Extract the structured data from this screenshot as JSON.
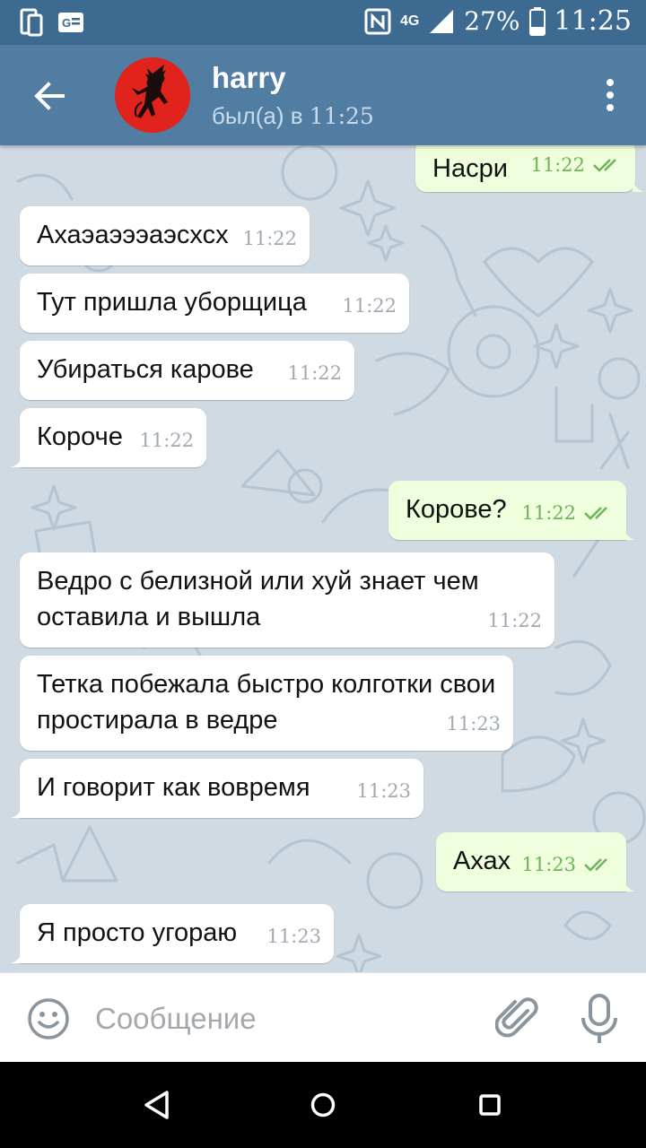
{
  "status_bar": {
    "network": "4G",
    "battery": "27%",
    "time": "11:25",
    "icons": [
      "phone-icon",
      "news-icon",
      "nfc-icon",
      "signal-icon",
      "battery-icon"
    ]
  },
  "header": {
    "contact_name": "harry",
    "last_seen_prefix": "был(а) в",
    "last_seen_time": "11:25",
    "avatar_color": "#e0231c"
  },
  "messages": [
    {
      "dir": "out",
      "text": "Насри",
      "time": "11:22",
      "status": "read"
    },
    {
      "dir": "in",
      "text": "Ахаэаэээаэсхсх",
      "time": "11:22"
    },
    {
      "dir": "in",
      "text": "Тут пришла уборщица",
      "time": "11:22"
    },
    {
      "dir": "in",
      "text": "Убираться карове",
      "time": "11:22"
    },
    {
      "dir": "in",
      "text": "Короче",
      "time": "11:22"
    },
    {
      "dir": "out",
      "text": "Корове?",
      "time": "11:22",
      "status": "read"
    },
    {
      "dir": "in",
      "text": "Ведро с белизной или хуй знает чем оставила и вышла",
      "time": "11:22"
    },
    {
      "dir": "in",
      "text": "Тетка побежала быстро колготки свои простирала в ведре",
      "time": "11:23"
    },
    {
      "dir": "in",
      "text": "И говорит как вовремя",
      "time": "11:23"
    },
    {
      "dir": "out",
      "text": "Ахах",
      "time": "11:23",
      "status": "read"
    },
    {
      "dir": "in",
      "text": "Я просто угораю",
      "time": "11:23"
    }
  ],
  "composer": {
    "placeholder": "Сообщение"
  },
  "colors": {
    "header": "#517da2",
    "status_bar": "#3d6a91",
    "chat_bg": "#cfdae3",
    "incoming": "#ffffff",
    "outgoing": "#effedd",
    "check": "#6cb55a"
  }
}
